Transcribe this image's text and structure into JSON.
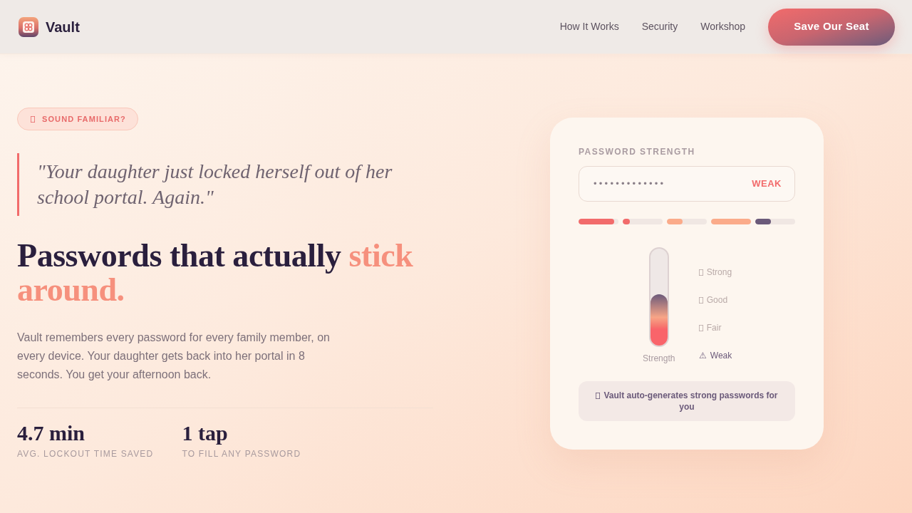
{
  "nav": {
    "brand": "Vault",
    "links": [
      {
        "label": "How It Works"
      },
      {
        "label": "Security"
      },
      {
        "label": "Workshop"
      }
    ],
    "cta": "Save Our Seat"
  },
  "hero": {
    "badge": "SOUND FAMILIAR?",
    "quote": "\"Your daughter just locked herself out of her school portal. Again.\"",
    "headline": {
      "text": "Passwords that actually",
      "accent": "stick around."
    },
    "body": "Vault remembers every password for every family member, on every device. Your daughter gets back into her portal in 8 seconds. You get your afternoon back.",
    "stats": [
      {
        "value": "4.7 min",
        "label": "AVG. LOCKOUT TIME SAVED"
      },
      {
        "value": "1 tap",
        "label": "TO FILL ANY PASSWORD"
      }
    ]
  },
  "strength_card": {
    "title": "PASSWORD STRENGTH",
    "password": "•••••••••••••",
    "rating": "WEAK",
    "segments": [
      {
        "level": 0.9,
        "color": "#f26b6b"
      },
      {
        "level": 0.18,
        "color": "#f26b6b"
      },
      {
        "level": 0.39,
        "color": "#fbab8a"
      },
      {
        "level": 1,
        "color": "#fbab8a"
      },
      {
        "level": 0.39,
        "color": "#6b5a7a"
      }
    ],
    "meter": {
      "level": 0.53,
      "label": "Strength"
    },
    "levels": [
      {
        "label": "Strong",
        "selected": false
      },
      {
        "label": "Good",
        "selected": false
      },
      {
        "label": "Fair",
        "selected": false
      },
      {
        "label": "Weak",
        "symbol": "⚠",
        "selected": true
      }
    ],
    "tip": "Vault auto-generates strong passwords for you"
  }
}
